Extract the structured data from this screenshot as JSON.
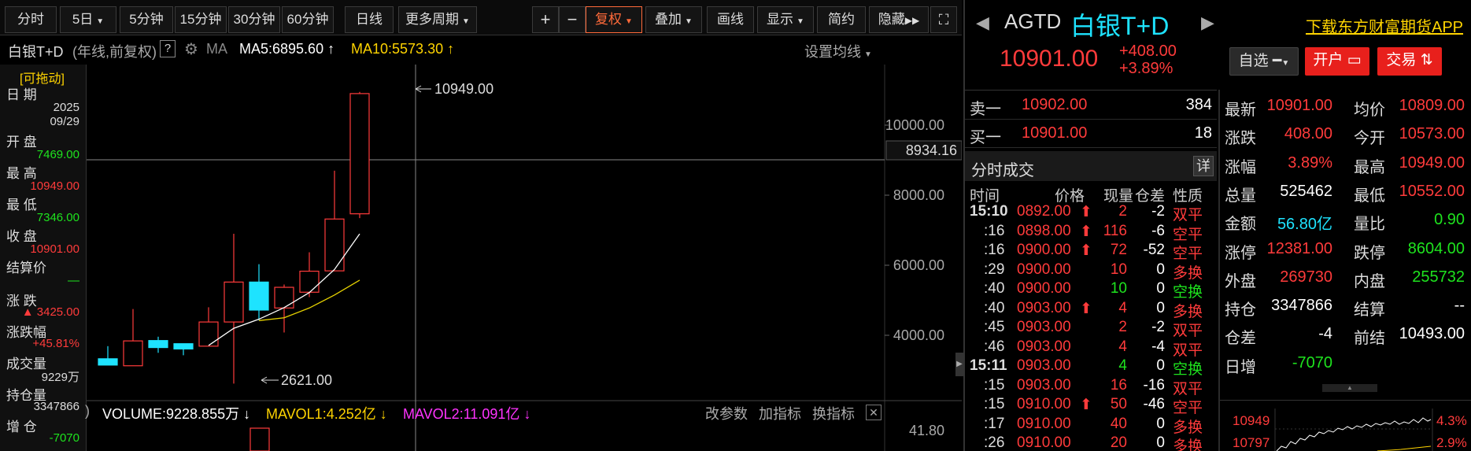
{
  "toolbar": {
    "periods": [
      "分时",
      "5日",
      "5分钟",
      "15分钟",
      "30分钟",
      "60分钟",
      "日线",
      "更多周期"
    ],
    "tools": [
      "+",
      "−",
      "复权",
      "叠加",
      "画线",
      "显示",
      "简约",
      "隐藏"
    ]
  },
  "chart_header": {
    "name": "白银T+D",
    "mode": "(年线,前复权)",
    "help": "?",
    "ma_label": "MA",
    "ma5": "MA5:6895.60",
    "ma10": "MA10:5573.30",
    "settings": "设置均线"
  },
  "info_panel": {
    "drag_hint": "[可拖动]",
    "date_label": "日 期",
    "date_year": "2025",
    "date_md": "09/29",
    "open_label": "开 盘",
    "open": "7469.00",
    "high_label": "最 高",
    "high": "10949.00",
    "low_label": "最 低",
    "low": "7346.00",
    "close_label": "收 盘",
    "close": "10901.00",
    "settle_label": "结算价",
    "settle": "—",
    "change_label": "涨 跌",
    "change": "▲ 3425.00",
    "pct_label": "涨跌幅",
    "pct": "+45.81%",
    "volume_label": "成交量",
    "volume": "9229万",
    "oi_label": "持仓量",
    "oi": "3347866",
    "oi_chg_label": "增 仓",
    "oi_chg": "-7070"
  },
  "chart_data": {
    "type": "candlestick",
    "y_ticks": [
      "10000.00",
      "8000.00",
      "6000.00",
      "4000.00"
    ],
    "crosshair_value": "8934.16",
    "high_annotation": "10949.00",
    "low_annotation": "2621.00",
    "candles": [
      {
        "open": 3330,
        "close": 3150,
        "high": 3690,
        "low": 3150
      },
      {
        "open": 3130,
        "close": 3840,
        "high": 4750,
        "low": 3130
      },
      {
        "open": 3850,
        "close": 3650,
        "high": 3960,
        "low": 3500
      },
      {
        "open": 3760,
        "close": 3610,
        "high": 3750,
        "low": 3430
      },
      {
        "open": 3690,
        "close": 4380,
        "high": 4800,
        "low": 3690
      },
      {
        "open": 4380,
        "close": 5520,
        "high": 6900,
        "low": 2621
      },
      {
        "open": 5520,
        "close": 4720,
        "high": 6030,
        "low": 4430
      },
      {
        "open": 4780,
        "close": 5370,
        "high": 5450,
        "low": 4080
      },
      {
        "open": 5230,
        "close": 5830,
        "high": 6370,
        "low": 5090
      },
      {
        "open": 5840,
        "close": 7320,
        "high": 8700,
        "low": 5830
      },
      {
        "open": 7469,
        "close": 10901,
        "high": 10949,
        "low": 7346
      }
    ],
    "ma5": [
      null,
      null,
      null,
      null,
      3710,
      4200,
      4460,
      4790,
      5220,
      5880,
      6895.6
    ],
    "ma10": [
      null,
      null,
      null,
      null,
      null,
      null,
      4420,
      4500,
      4780,
      5150,
      5573.3
    ],
    "volume_pane": {
      "label": "VOLUME:9228.855万",
      "mavol1": "MAVOL1:4.252亿",
      "mavol2": "MAVOL2:11.091亿",
      "y_tick": "41.80",
      "actions": [
        "改参数",
        "加指标",
        "换指标"
      ]
    }
  },
  "right_panel": {
    "code": "AGTD",
    "name": "白银T+D",
    "download": "下载东方财富期货APP",
    "price": "10901.00",
    "change": "+408.00",
    "pct": "+3.89%",
    "watch_btn": "自选",
    "open_btn": "开户",
    "trade_btn": "交易",
    "orderbook": [
      {
        "label": "卖一",
        "price": "10902.00",
        "vol": "384"
      },
      {
        "label": "买一",
        "price": "10901.00",
        "vol": "18"
      }
    ],
    "ticks_title": "分时成交",
    "ticks_detail": "详",
    "ticks_headers": [
      "时间",
      "价格",
      "现量",
      "仓差",
      "性质"
    ],
    "ticks": [
      {
        "time": "15:10",
        "price": "0892.00",
        "arrow": true,
        "vol": "2",
        "diff": "-2",
        "type": "双平",
        "pc": "red",
        "vc": "red",
        "tc": "red"
      },
      {
        "time": ":16",
        "price": "0898.00",
        "arrow": true,
        "vol": "116",
        "diff": "-6",
        "type": "空平",
        "pc": "red",
        "vc": "red",
        "tc": "red"
      },
      {
        "time": ":16",
        "price": "0900.00",
        "arrow": true,
        "vol": "72",
        "diff": "-52",
        "type": "空平",
        "pc": "red",
        "vc": "red",
        "tc": "red"
      },
      {
        "time": ":29",
        "price": "0900.00",
        "arrow": false,
        "vol": "10",
        "diff": "0",
        "type": "多换",
        "pc": "red",
        "vc": "red",
        "tc": "red"
      },
      {
        "time": ":40",
        "price": "0900.00",
        "arrow": false,
        "vol": "10",
        "diff": "0",
        "type": "空换",
        "pc": "red",
        "vc": "green",
        "tc": "green"
      },
      {
        "time": ":40",
        "price": "0903.00",
        "arrow": true,
        "vol": "4",
        "diff": "0",
        "type": "多换",
        "pc": "red",
        "vc": "red",
        "tc": "red"
      },
      {
        "time": ":45",
        "price": "0903.00",
        "arrow": false,
        "vol": "2",
        "diff": "-2",
        "type": "双平",
        "pc": "red",
        "vc": "red",
        "tc": "red"
      },
      {
        "time": ":46",
        "price": "0903.00",
        "arrow": false,
        "vol": "4",
        "diff": "-4",
        "type": "双平",
        "pc": "red",
        "vc": "red",
        "tc": "red"
      },
      {
        "time": "15:11",
        "price": "0903.00",
        "arrow": false,
        "vol": "4",
        "diff": "0",
        "type": "空换",
        "pc": "red",
        "vc": "green",
        "tc": "green"
      },
      {
        "time": ":15",
        "price": "0903.00",
        "arrow": false,
        "vol": "16",
        "diff": "-16",
        "type": "双平",
        "pc": "red",
        "vc": "red",
        "tc": "red"
      },
      {
        "time": ":15",
        "price": "0910.00",
        "arrow": true,
        "vol": "50",
        "diff": "-46",
        "type": "空平",
        "pc": "red",
        "vc": "red",
        "tc": "red"
      },
      {
        "time": ":17",
        "price": "0910.00",
        "arrow": false,
        "vol": "40",
        "diff": "0",
        "type": "多换",
        "pc": "red",
        "vc": "red",
        "tc": "red"
      },
      {
        "time": ":26",
        "price": "0910.00",
        "arrow": false,
        "vol": "20",
        "diff": "0",
        "type": "多换",
        "pc": "red",
        "vc": "red",
        "tc": "red"
      }
    ],
    "quotes": [
      {
        "l1": "最新",
        "v1": "10901.00",
        "c1": "red",
        "l2": "均价",
        "v2": "10809.00",
        "c2": "red"
      },
      {
        "l1": "涨跌",
        "v1": "408.00",
        "c1": "red",
        "l2": "今开",
        "v2": "10573.00",
        "c2": "red"
      },
      {
        "l1": "涨幅",
        "v1": "3.89%",
        "c1": "red",
        "l2": "最高",
        "v2": "10949.00",
        "c2": "red"
      },
      {
        "l1": "总量",
        "v1": "525462",
        "c1": "white",
        "l2": "最低",
        "v2": "10552.00",
        "c2": "red"
      },
      {
        "l1": "金额",
        "v1": "56.80亿",
        "c1": "cyan",
        "l2": "量比",
        "v2": "0.90",
        "c2": "green"
      },
      {
        "l1": "涨停",
        "v1": "12381.00",
        "c1": "red",
        "l2": "跌停",
        "v2": "8604.00",
        "c2": "green"
      },
      {
        "l1": "外盘",
        "v1": "269730",
        "c1": "red",
        "l2": "内盘",
        "v2": "255732",
        "c2": "green"
      },
      {
        "l1": "持仓",
        "v1": "3347866",
        "c1": "white",
        "l2": "结算",
        "v2": "--",
        "c2": "white"
      },
      {
        "l1": "仓差",
        "v1": "-4",
        "c1": "white",
        "l2": "前结",
        "v2": "10493.00",
        "c2": "white"
      },
      {
        "l1": "日增",
        "v1": "-7070",
        "c1": "green",
        "l2": "",
        "v2": "",
        "c2": "white"
      }
    ],
    "mini_chart": {
      "left_top": "10949",
      "left_bottom": "10797",
      "right_top": "4.3%",
      "right_bottom": "2.9%"
    }
  }
}
